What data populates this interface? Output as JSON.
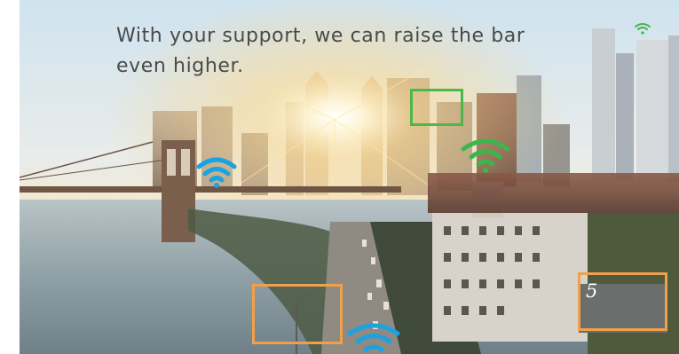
{
  "headline": "With your support, we can raise the bar even higher.",
  "overlay_label": "5",
  "colors": {
    "wifi_blue": "#1aa3e0",
    "wifi_green": "#3cb54a",
    "box_green": "#4cb848",
    "box_orange": "#f0a04b",
    "headline_text": "#4a4a4a"
  },
  "icons": [
    "wifi-icon",
    "wifi-icon",
    "wifi-icon",
    "wifi-icon"
  ]
}
